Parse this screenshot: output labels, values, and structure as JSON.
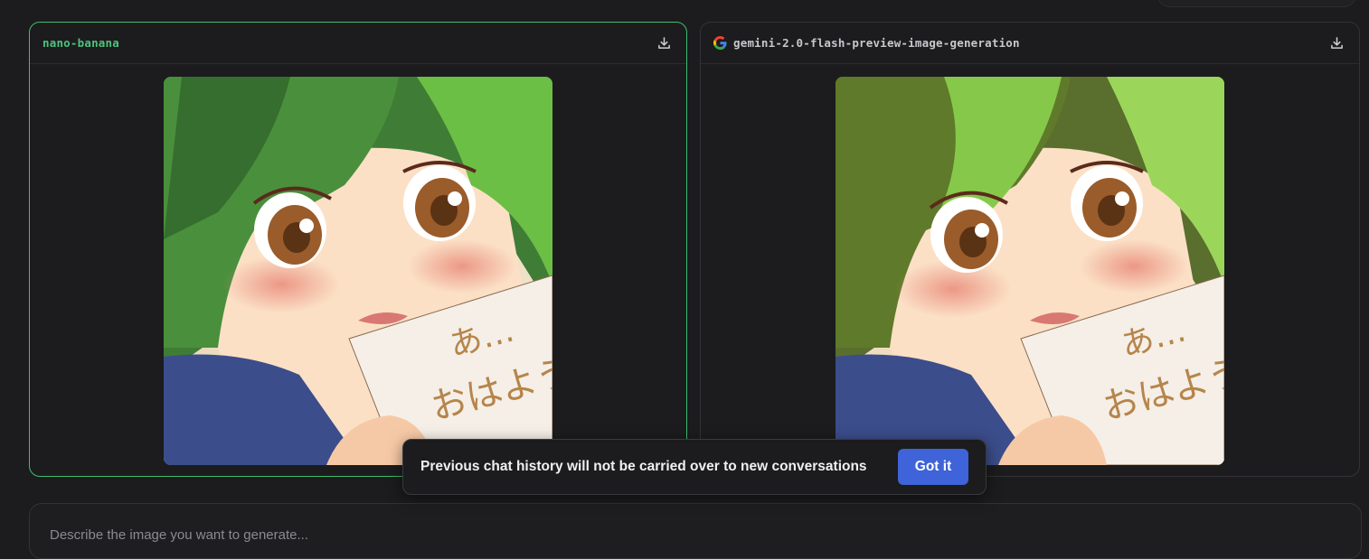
{
  "panels": [
    {
      "model_name": "nano-banana",
      "download_icon": "download-icon"
    },
    {
      "model_name": "gemini-2.0-flash-preview-image-generation",
      "provider_icon": "google-g-icon",
      "download_icon": "download-icon"
    }
  ],
  "image_text": {
    "line1": "あ…",
    "line2": "おはよう"
  },
  "toast": {
    "message": "Previous chat history will not be carried over to new conversations",
    "button_label": "Got it",
    "button_color": "#3f63d8"
  },
  "prompt": {
    "placeholder": "Describe the image you want to generate..."
  },
  "colors": {
    "accent_green": "#3fbf6f",
    "background": "#1c1c1e"
  }
}
